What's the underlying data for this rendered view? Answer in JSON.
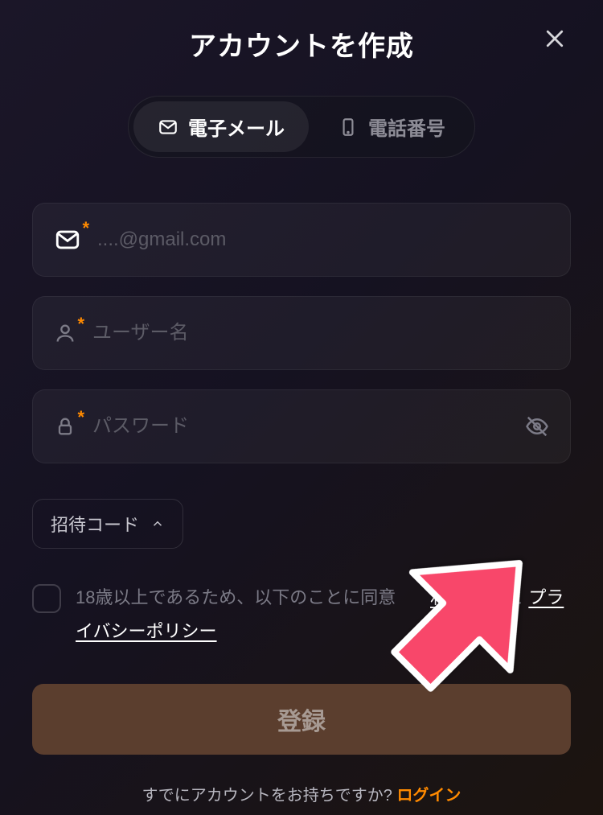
{
  "header": {
    "title": "アカウントを作成"
  },
  "tabs": {
    "email": "電子メール",
    "phone": "電話番号"
  },
  "fields": {
    "email_placeholder": "....@gmail.com",
    "username_placeholder": "ユーザー名",
    "password_placeholder": "パスワード"
  },
  "invite": {
    "label": "招待コード"
  },
  "consent": {
    "prefix": "18歳以上であるため、以下のことに同意",
    "terms": "利用規約",
    "and": " と ",
    "privacy": "プライバシーポリシー"
  },
  "submit": {
    "label": "登録"
  },
  "footer": {
    "prompt": "すでにアカウントをお持ちですか? ",
    "login": "ログイン"
  }
}
